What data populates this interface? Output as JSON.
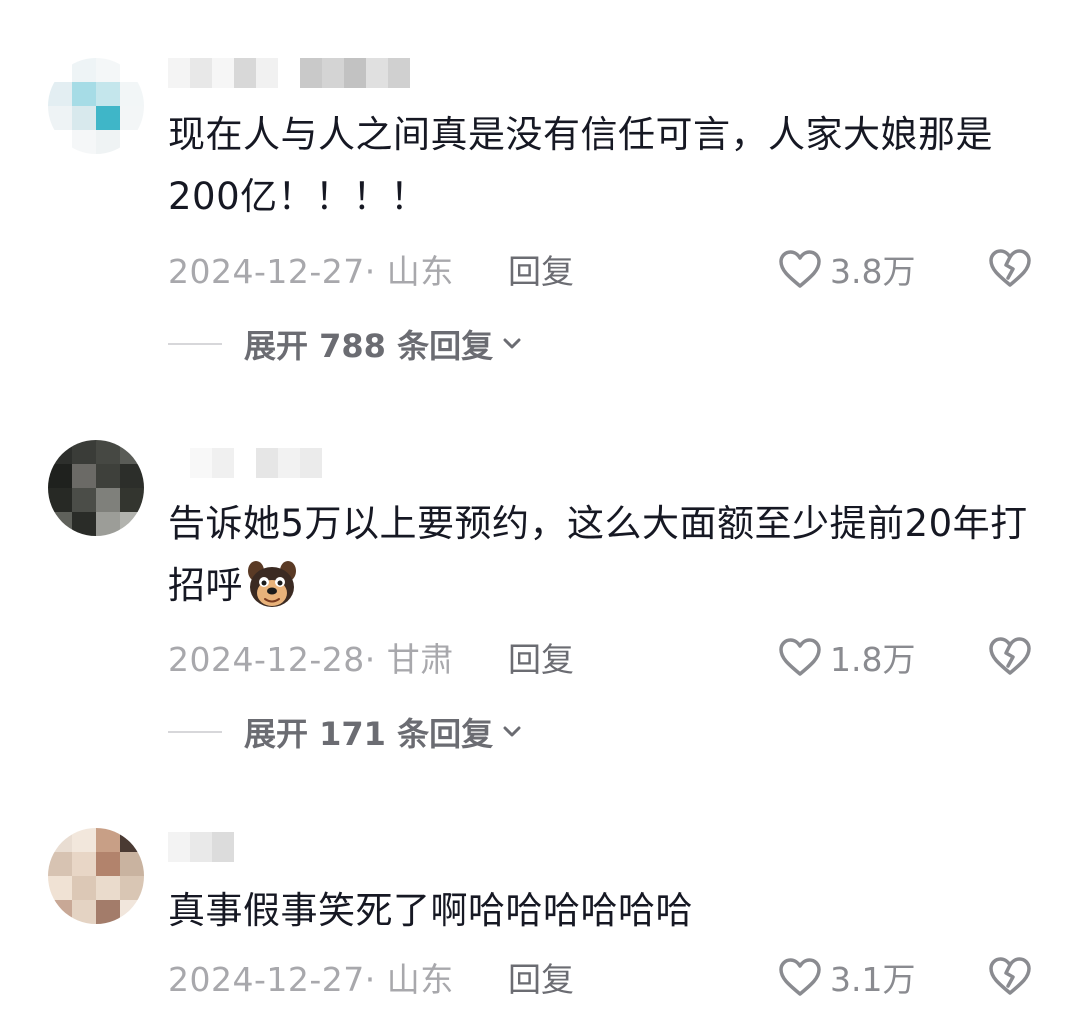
{
  "comments": [
    {
      "text": "现在人与人之间真是没有信任可言，人家大娘那是200亿！！！！",
      "date_location": "2024-12-27· 山东",
      "reply_label": "回复",
      "likes": "3.8万",
      "expand_label": "展开 788 条回复"
    },
    {
      "text": "告诉她5万以上要预约，这么大面额至少提前20年打招呼",
      "date_location": "2024-12-28· 甘肃",
      "reply_label": "回复",
      "likes": "1.8万",
      "expand_label": "展开 171 条回复"
    },
    {
      "text": "真事假事笑死了啊哈哈哈哈哈哈",
      "date_location": "2024-12-27· 山东",
      "reply_label": "回复",
      "likes": "3.1万"
    }
  ],
  "icons": {
    "like": "heart-outline-icon",
    "dislike": "broken-heart-icon",
    "expand": "chevron-down-icon",
    "emoji": "dog-face-emoji"
  },
  "colors": {
    "text": "#161823",
    "meta": "#a8a8ac",
    "reply": "#6b6c72",
    "icon": "#8a8b90"
  }
}
